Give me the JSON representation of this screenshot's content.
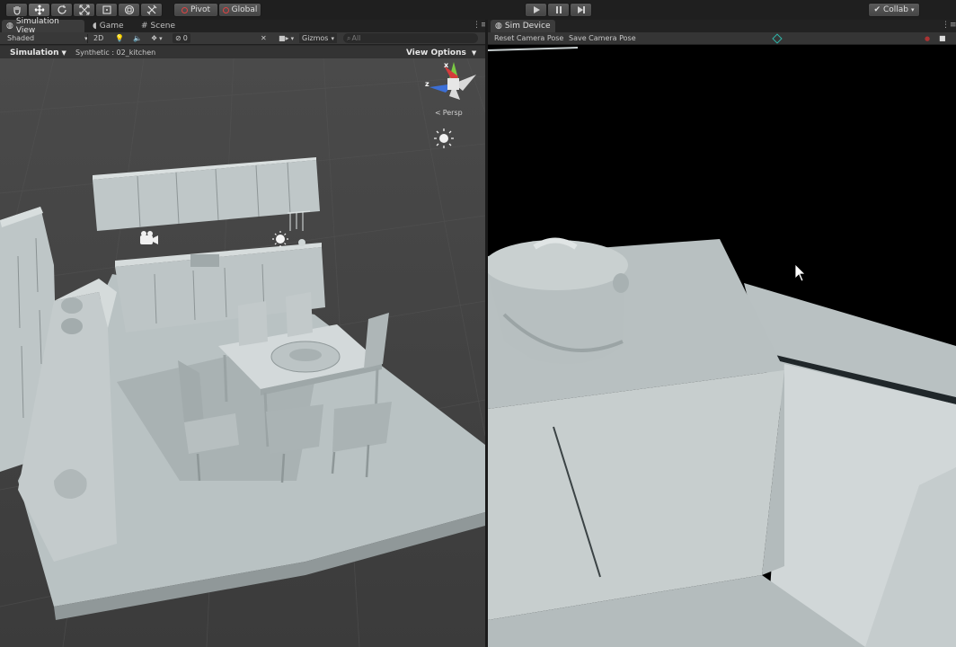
{
  "toolbar": {
    "tools": [
      "hand-tool",
      "move-tool",
      "rotate-tool",
      "scale-tool",
      "rect-tool",
      "transform-tool",
      "custom-tool"
    ],
    "pivot_label": "Pivot",
    "global_label": "Global",
    "collab_label": "Collab"
  },
  "left_tabs": [
    {
      "label": "Simulation View",
      "active": true
    },
    {
      "label": "Game",
      "active": false
    },
    {
      "label": "Scene",
      "active": false
    }
  ],
  "scene_bar": {
    "shading": "Shaded",
    "mode_2d": "2D",
    "fx_count": "0",
    "gizmos": "Gizmos",
    "search_placeholder": "All"
  },
  "sim_bar": {
    "simulation_label": "Simulation",
    "scene_name": "Synthetic : 02_kitchen",
    "view_options": "View Options"
  },
  "gizmo": {
    "persp_label": "Persp",
    "axis_x": "x",
    "axis_z": "z"
  },
  "right_tabs": [
    {
      "label": "Sim Device",
      "active": true
    }
  ],
  "device_bar": {
    "reset_pose": "Reset Camera Pose",
    "save_pose": "Save Camera Pose"
  },
  "colors": {
    "accent_teal": "#2fb5a8",
    "play_controls": "#cfcfcf",
    "axis_x": "#d43b3b",
    "axis_y": "#7ac943",
    "axis_z": "#3c6fd6"
  }
}
